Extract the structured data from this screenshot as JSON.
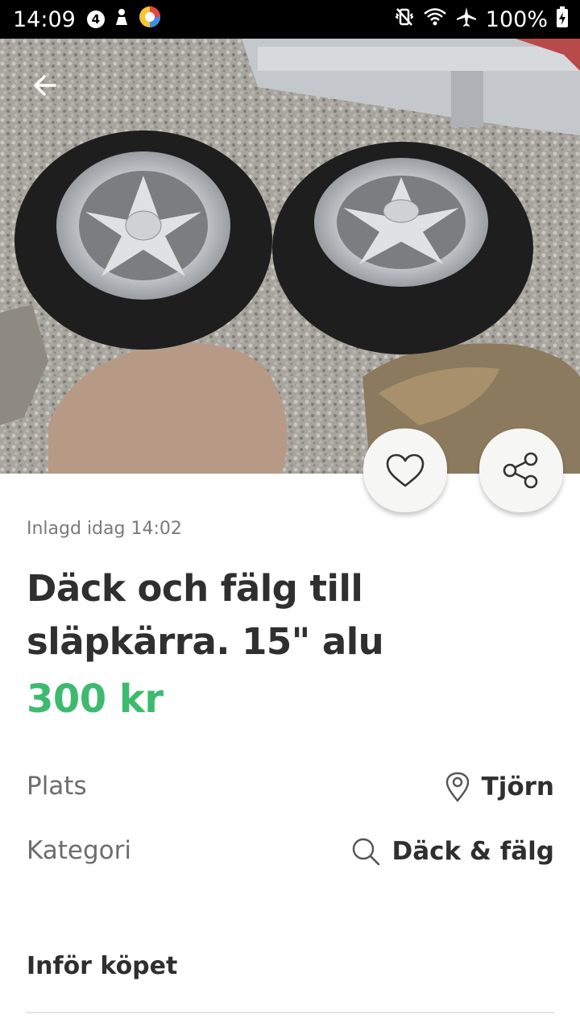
{
  "status_bar": {
    "time": "14:09",
    "notification_badge": "4",
    "battery": "100%",
    "icons": [
      "number-badge-icon",
      "notification-figure-icon",
      "app-colorful-icon",
      "vibrate-icon",
      "wifi-icon",
      "airplane-icon",
      "battery-charging-icon"
    ]
  },
  "listing": {
    "posted": "Inlagd idag 14:02",
    "title": "Däck och fälg till släpkärra. 15\" alu",
    "price": "300 kr",
    "price_color": "#3dba6e"
  },
  "details": {
    "location_label": "Plats",
    "location_value": "Tjörn",
    "category_label": "Kategori",
    "category_value": "Däck & fälg"
  },
  "section": {
    "title": "Inför köpet"
  },
  "icons": {
    "back": "arrow-left-icon",
    "favorite": "heart-icon",
    "share": "share-icon",
    "location": "map-pin-icon",
    "category": "search-icon"
  }
}
